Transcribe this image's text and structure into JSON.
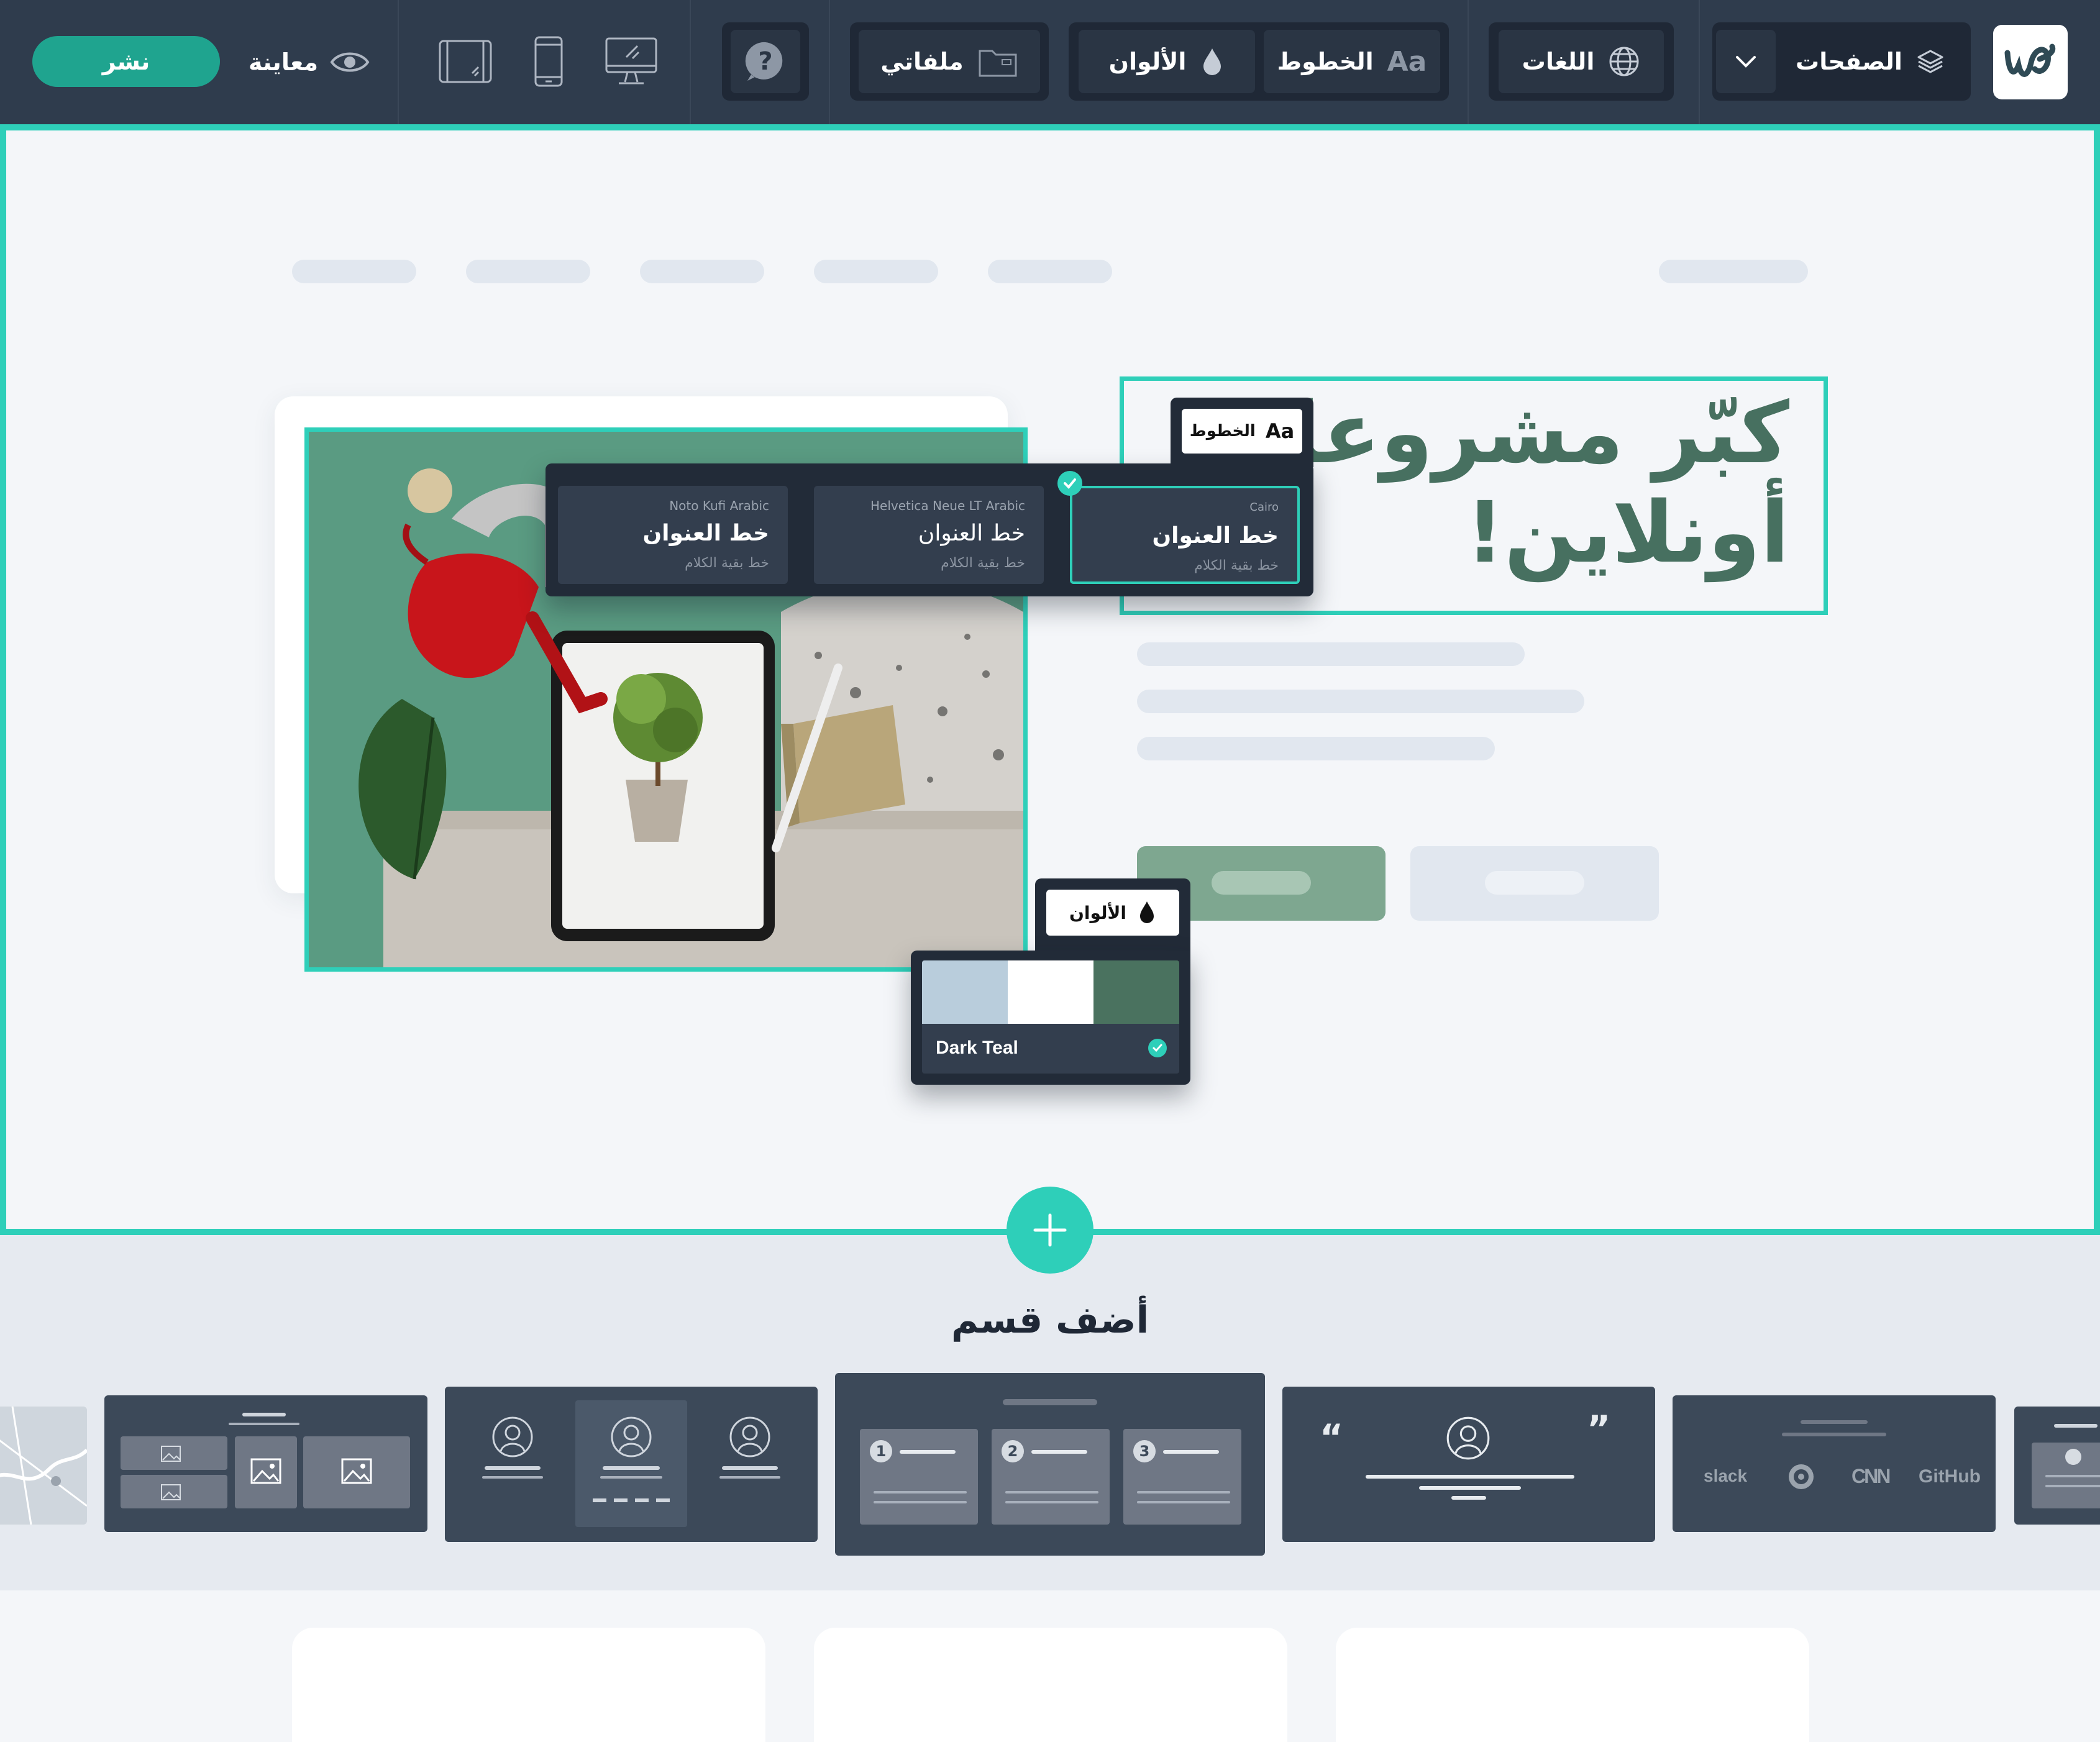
{
  "colors": {
    "accent": "#2ecfb9",
    "publish": "#1fa48f",
    "toolbar": "#2f3c4d",
    "headline": "#477060",
    "button_primary": "#7ea790"
  },
  "toolbar": {
    "publish_label": "نشر",
    "preview_label": "معاينة",
    "preview_icon": "eye-icon",
    "device_icons": [
      "tablet-icon",
      "mobile-icon",
      "desktop-icon"
    ],
    "help_icon": "help-icon",
    "files_label": "ملفاتي",
    "files_icon": "folder-icon",
    "colors_label": "الألوان",
    "colors_icon": "drop-icon",
    "fonts_label": "الخطوط",
    "fonts_glyph": "Aa",
    "languages_label": "اللغات",
    "languages_icon": "globe-icon",
    "pages_label": "الصفحات",
    "pages_icon": "layers-icon",
    "pages_dropdown_icon": "chevron-down-icon",
    "logo_text": "w"
  },
  "hero": {
    "headline_line1": "كبّر مشروعك",
    "headline_line2": "أونلاين!"
  },
  "fonts_panel": {
    "tag_label": "الخطوط",
    "tag_glyph": "Aa",
    "options": [
      {
        "font_name": "Cairo",
        "title": "خط العنوان",
        "sub": "خط بقية الكلام",
        "selected": true
      },
      {
        "font_name": "Helvetica Neue LT Arabic",
        "title": "خط العنوان",
        "sub": "خط بقية الكلام",
        "selected": false
      },
      {
        "font_name": "Noto Kufi Arabic",
        "title": "خط العنوان",
        "sub": "خط بقية الكلام",
        "selected": false
      }
    ]
  },
  "colors_panel": {
    "tag_label": "الألوان",
    "palette_name": "Dark Teal",
    "swatches": [
      "#b9cddc",
      "#ffffff",
      "#4a725f"
    ],
    "selected": true
  },
  "add_section": {
    "label": "أضف قسم",
    "add_icon": "plus-icon",
    "logos": [
      "slack",
      "CNN",
      "GitHub"
    ],
    "quote_open": "“",
    "quote_close": "”",
    "steps": [
      "1",
      "2",
      "3"
    ]
  }
}
